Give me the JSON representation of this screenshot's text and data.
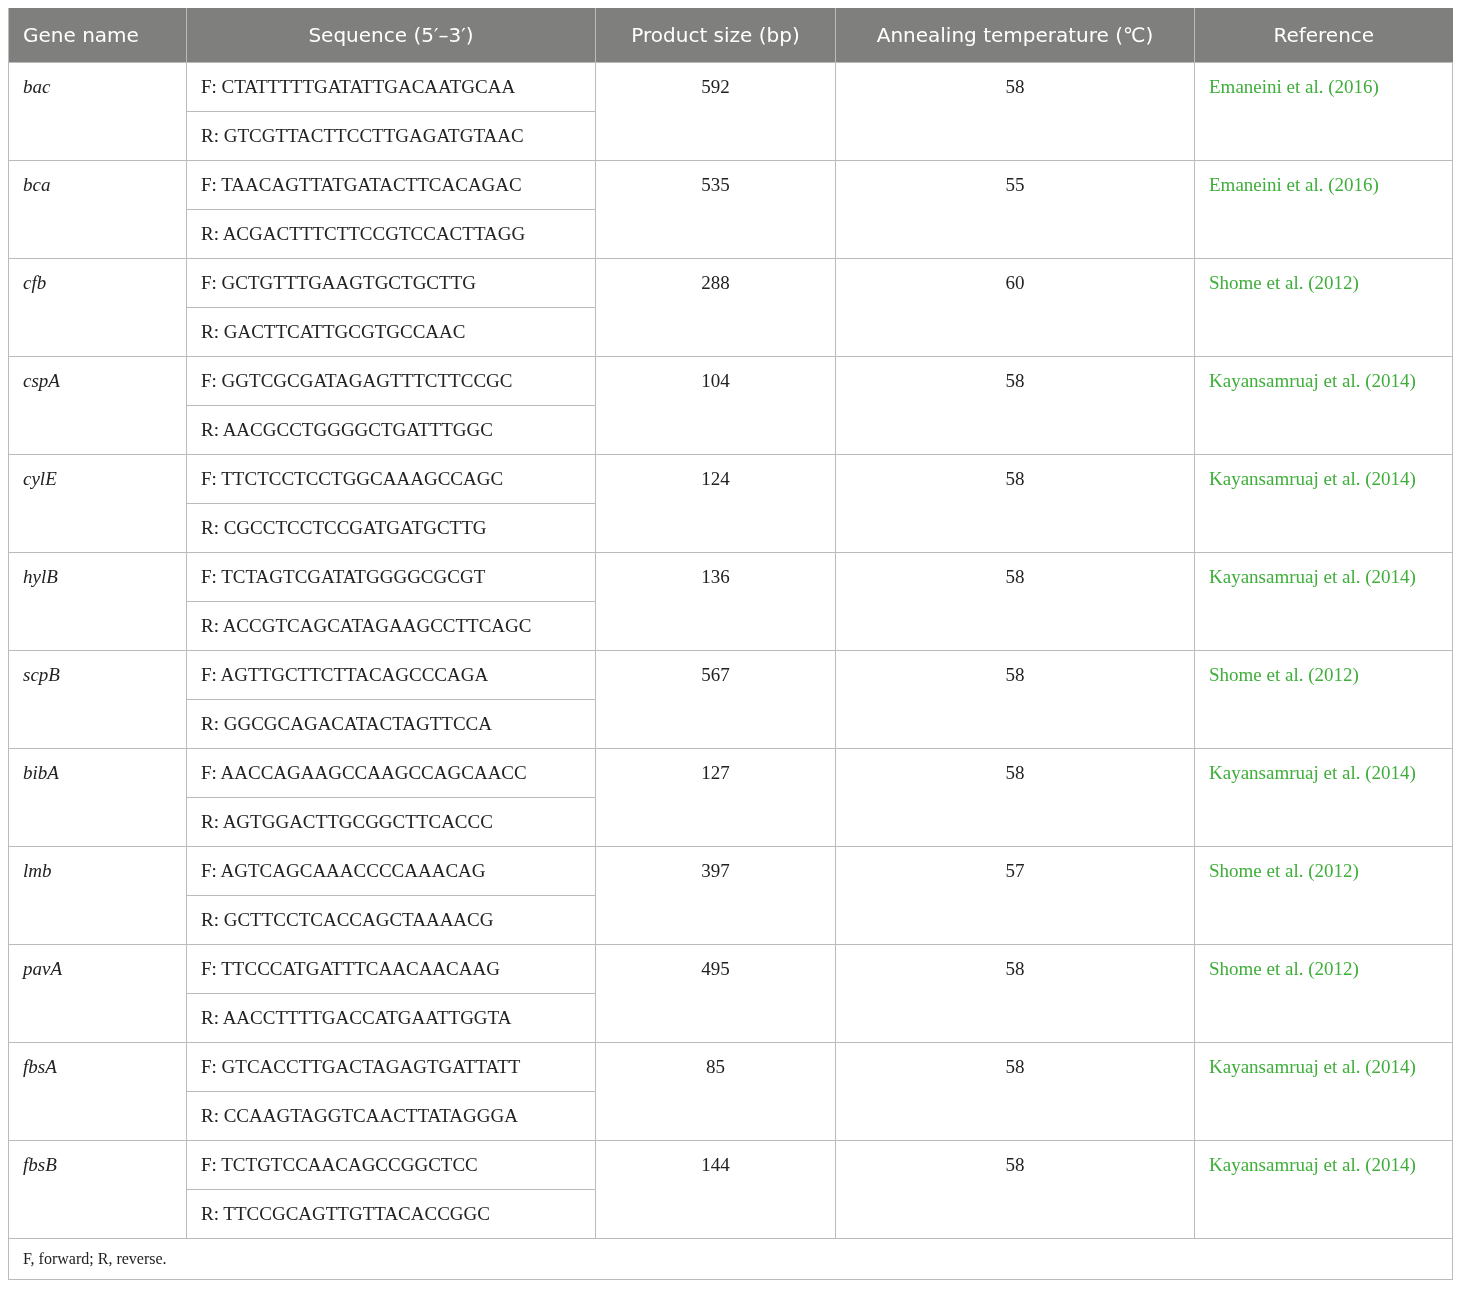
{
  "table": {
    "columns": [
      "Gene name",
      "Sequence (5′–3′)",
      "Product size (bp)",
      "Annealing temperature (℃)",
      "Reference"
    ],
    "rows": [
      {
        "gene": "bac",
        "forward": "F: CTATTTTTGATATTGACAATGCAA",
        "reverse": "R: GTCGTTACTTCCTTGAGATGTAAC",
        "product_size": "592",
        "annealing_temperature": "58",
        "reference": "Emaneini et al. (2016)"
      },
      {
        "gene": "bca",
        "forward": "F: TAACAGTTATGATACTTCACAGAC",
        "reverse": "R: ACGACTTTCTTCCGTCCACTTAGG",
        "product_size": "535",
        "annealing_temperature": "55",
        "reference": "Emaneini et al. (2016)"
      },
      {
        "gene": "cfb",
        "forward": "F: GCTGTTTGAAGTGCTGCTTG",
        "reverse": "R: GACTTCATTGCGTGCCAAC",
        "product_size": "288",
        "annealing_temperature": "60",
        "reference": "Shome et al. (2012)"
      },
      {
        "gene": "cspA",
        "forward": "F: GGTCGCGATAGAGTTTCTTCCGC",
        "reverse": "R: AACGCCTGGGGCTGATTTGGC",
        "product_size": "104",
        "annealing_temperature": "58",
        "reference": "Kayansamruaj et al. (2014)"
      },
      {
        "gene": "cylE",
        "forward": "F: TTCTCCTCCTGGCAAAGCCAGC",
        "reverse": "R: CGCCTCCTCCGATGATGCTTG",
        "product_size": "124",
        "annealing_temperature": "58",
        "reference": "Kayansamruaj et al. (2014)"
      },
      {
        "gene": "hylB",
        "forward": "F: TCTAGTCGATATGGGGCGCGT",
        "reverse": "R: ACCGTCAGCATAGAAGCCTTCAGC",
        "product_size": "136",
        "annealing_temperature": "58",
        "reference": "Kayansamruaj et al. (2014)"
      },
      {
        "gene": "scpB",
        "forward": "F: AGTTGCTTCTTACAGCCCAGA",
        "reverse": "R: GGCGCAGACATACTAGTTCCA",
        "product_size": "567",
        "annealing_temperature": "58",
        "reference": "Shome et al. (2012)"
      },
      {
        "gene": "bibA",
        "forward": "F: AACCAGAAGCCAAGCCAGCAACC",
        "reverse": "R: AGTGGACTTGCGGCTTCACCC",
        "product_size": "127",
        "annealing_temperature": "58",
        "reference": "Kayansamruaj et al. (2014)"
      },
      {
        "gene": "lmb",
        "forward": "F: AGTCAGCAAACCCCAAACAG",
        "reverse": "R: GCTTCCTCACCAGCTAAAACG",
        "product_size": "397",
        "annealing_temperature": "57",
        "reference": "Shome et al. (2012)"
      },
      {
        "gene": "pavA",
        "forward": "F: TTCCCATGATTTCAACAACAAG",
        "reverse": "R: AACCTTTTGACCATGAATTGGTA",
        "product_size": "495",
        "annealing_temperature": "58",
        "reference": "Shome et al. (2012)"
      },
      {
        "gene": "fbsA",
        "forward": "F: GTCACCTTGACTAGAGTGATTATT",
        "reverse": "R: CCAAGTAGGTCAACTTATAGGGA",
        "product_size": "85",
        "annealing_temperature": "58",
        "reference": "Kayansamruaj et al. (2014)"
      },
      {
        "gene": "fbsB",
        "forward": "F: TCTGTCCAACAGCCGGCTCC",
        "reverse": "R: TTCCGCAGTTGTTACACCGGC",
        "product_size": "144",
        "annealing_temperature": "58",
        "reference": "Kayansamruaj et al. (2014)"
      }
    ],
    "footnote": "F, forward; R, reverse."
  }
}
